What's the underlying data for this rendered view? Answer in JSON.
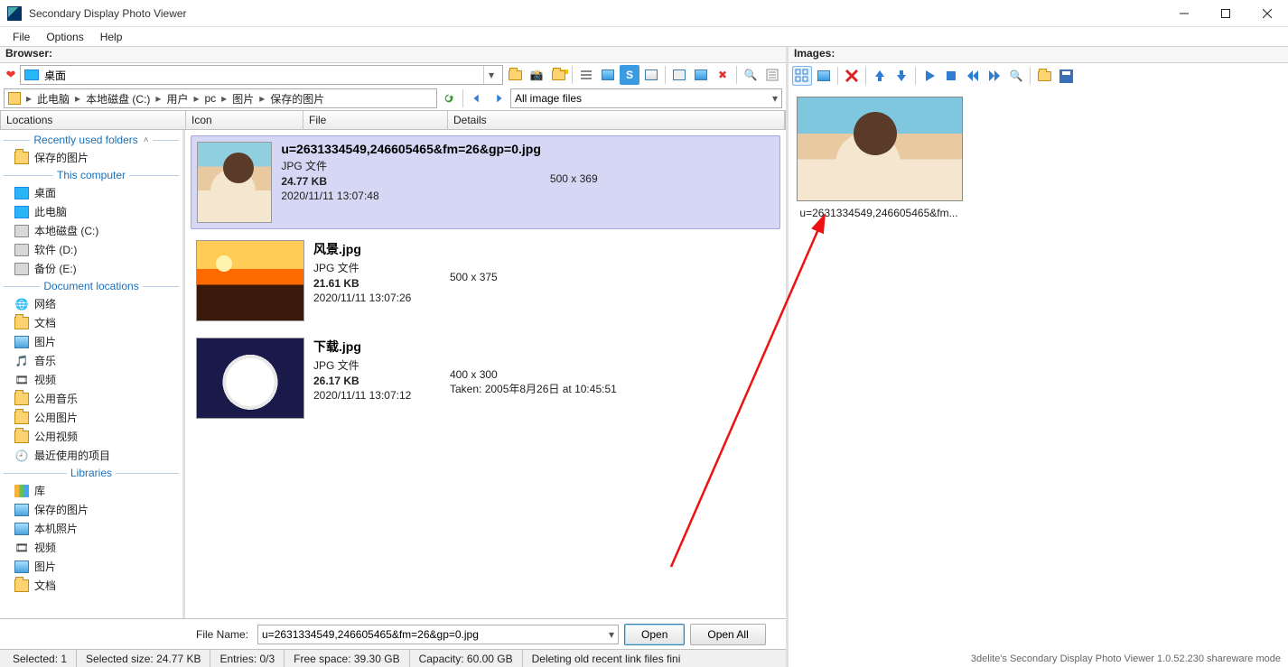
{
  "window": {
    "title": "Secondary Display Photo Viewer"
  },
  "menubar": {
    "file": "File",
    "options": "Options",
    "help": "Help"
  },
  "browser": {
    "header": "Browser:",
    "combo_label": "桌面",
    "filter_label": "All image files",
    "breadcrumbs": [
      "此电脑",
      "本地磁盘 (C:)",
      "用户",
      "pc",
      "图片",
      "保存的图片"
    ],
    "cols": {
      "locations": "Locations",
      "icon": "Icon",
      "file": "File",
      "details": "Details"
    }
  },
  "tree": {
    "sections": {
      "recent": "Recently used folders",
      "computer": "This computer",
      "doclocs": "Document locations",
      "libraries": "Libraries"
    },
    "recent": [
      "保存的图片"
    ],
    "computer": [
      "桌面",
      "此电脑",
      "本地磁盘 (C:)",
      "软件 (D:)",
      "备份 (E:)"
    ],
    "doclocs": [
      "网络",
      "文档",
      "图片",
      "音乐",
      "视频",
      "公用音乐",
      "公用图片",
      "公用视频",
      "最近使用的项目"
    ],
    "libraries": [
      "库",
      "保存的图片",
      "本机照片",
      "视频",
      "图片",
      "文档"
    ]
  },
  "files": [
    {
      "name": "u=2631334549,246605465&fm=26&gp=0.jpg",
      "type": "JPG 文件",
      "size": "24.77 KB",
      "date": "2020/11/11 13:07:48",
      "dims": "500 x 369",
      "taken": "",
      "thumbClass": "anime",
      "selected": true
    },
    {
      "name": "风景.jpg",
      "type": "JPG 文件",
      "size": "21.61 KB",
      "date": "2020/11/11 13:07:26",
      "dims": "500 x 375",
      "taken": "",
      "thumbClass": "sunset",
      "selected": false
    },
    {
      "name": "下载.jpg",
      "type": "JPG 文件",
      "size": "26.17 KB",
      "date": "2020/11/11 13:07:12",
      "dims": "400 x 300",
      "taken": "Taken: 2005年8月26日 at 10:45:51",
      "thumbClass": "cat",
      "selected": false
    }
  ],
  "bottom": {
    "filename_label": "File Name:",
    "filename_value": "u=2631334549,246605465&fm=26&gp=0.jpg",
    "open": "Open",
    "open_all": "Open All"
  },
  "status": {
    "selected": "Selected: 1",
    "selsize": "Selected size: 24.77 KB",
    "entries": "Entries: 0/3",
    "free": "Free space: 39.30 GB",
    "capacity": "Capacity: 60.00 GB",
    "msg": "Deleting old recent link files fini"
  },
  "images_panel": {
    "header": "Images:",
    "thumb_name": "u=2631334549,246605465&fm..."
  },
  "footer": "3delite's Secondary Display Photo Viewer 1.0.52.230 shareware mode"
}
